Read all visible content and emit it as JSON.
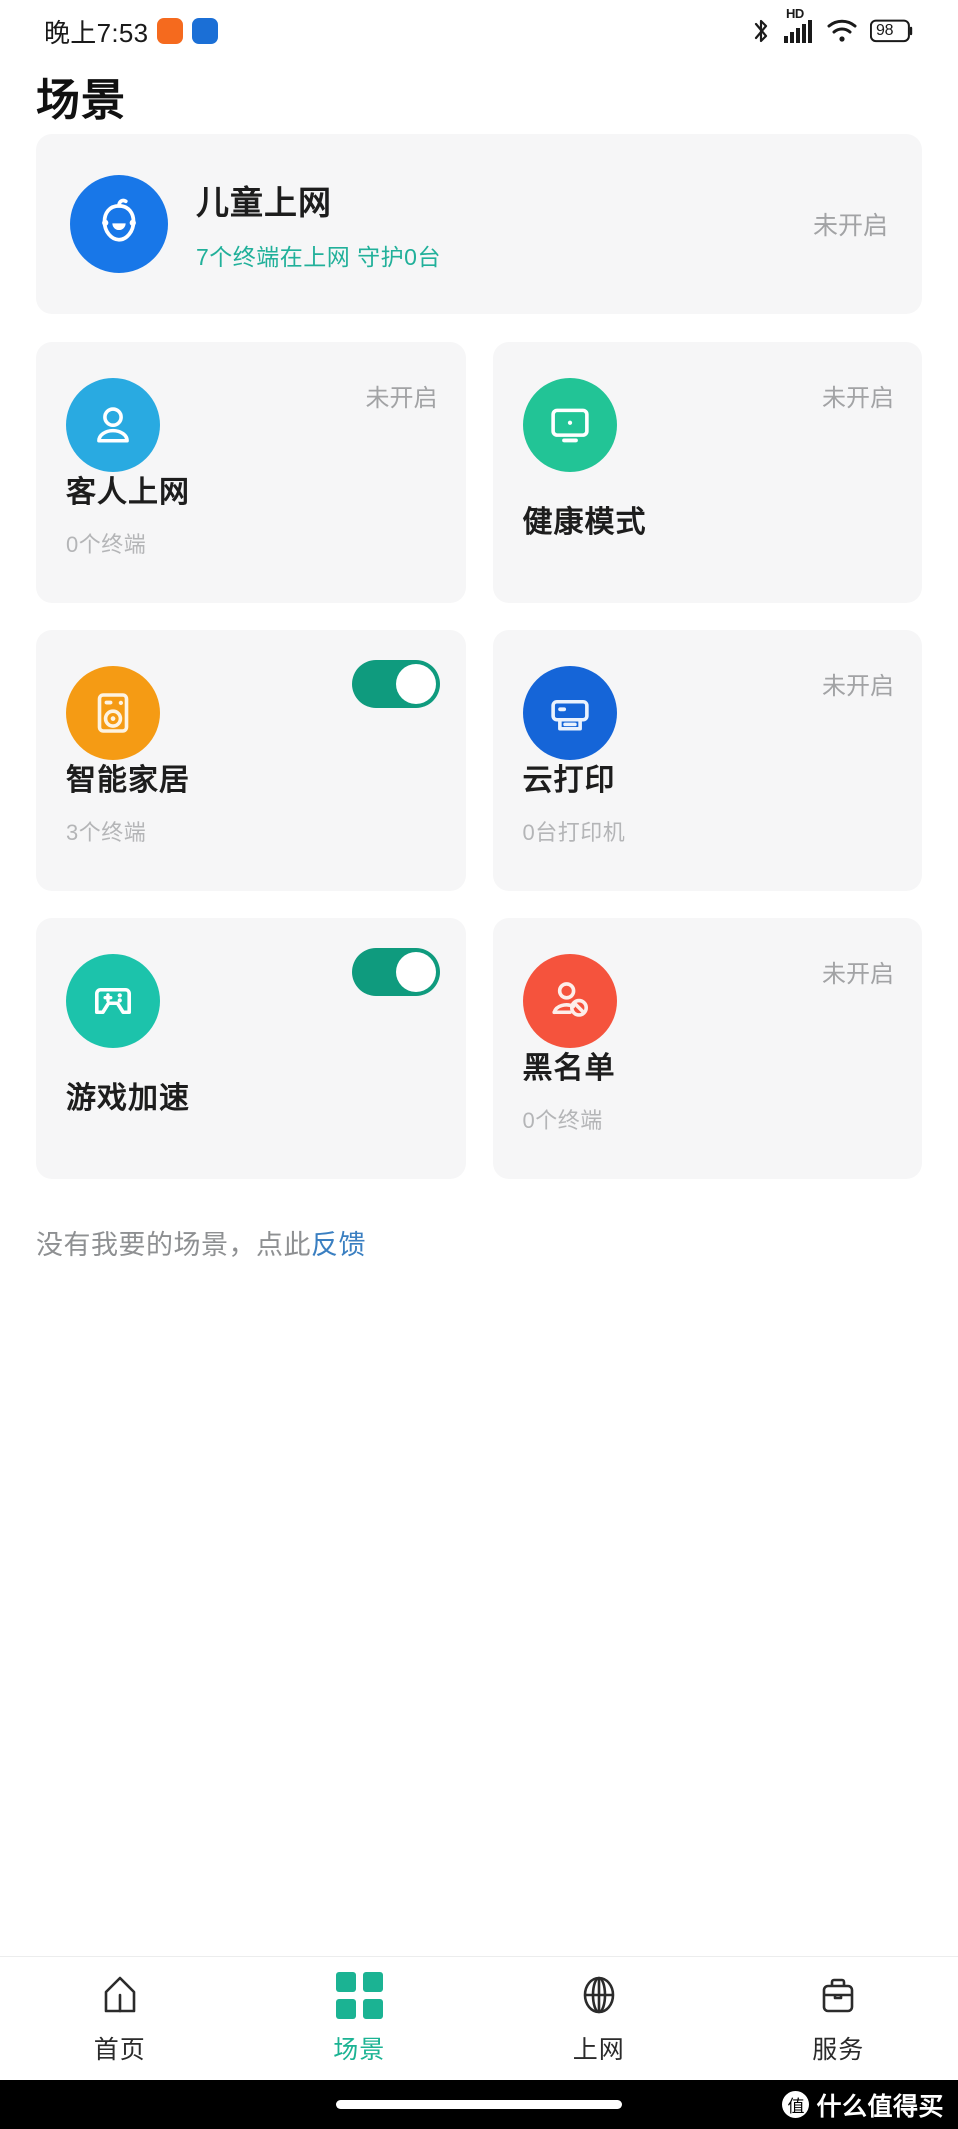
{
  "status_bar": {
    "time": "晚上7:53",
    "app_icons": [
      {
        "name": "mi-app-icon",
        "color": "#f56a1e"
      },
      {
        "name": "blue-app-icon",
        "color": "#1b6fd6"
      }
    ],
    "bluetooth_icon": "bluetooth-icon",
    "network_label": "HD",
    "signal_icon": "cellular-signal-icon",
    "wifi_icon": "wifi-icon",
    "battery_level": "98"
  },
  "header": {
    "title": "场景"
  },
  "hero_card": {
    "title": "儿童上网",
    "subtitle": "7个终端在上网  守护0台",
    "status": "未开启",
    "icon": "baby-face-icon",
    "icon_color": "#1877e8",
    "subtitle_color": "#21b09a"
  },
  "scene_cards": [
    {
      "title": "客人上网",
      "subtitle": "0个终端",
      "status": "未开启",
      "control": "status",
      "icon": "guest-person-icon",
      "icon_color": "#29aae1"
    },
    {
      "title": "健康模式",
      "subtitle": "",
      "status": "未开启",
      "control": "status",
      "icon": "monitor-icon",
      "icon_color": "#22c496"
    },
    {
      "title": "智能家居",
      "subtitle": "3个终端",
      "status": "",
      "control": "toggle",
      "toggle_on": true,
      "icon": "smart-appliance-icon",
      "icon_color": "#f59b14"
    },
    {
      "title": "云打印",
      "subtitle": "0台打印机",
      "status": "未开启",
      "control": "status",
      "icon": "printer-icon",
      "icon_color": "#1565d8"
    },
    {
      "title": "游戏加速",
      "subtitle": "",
      "status": "",
      "control": "toggle",
      "toggle_on": true,
      "icon": "gamepad-icon",
      "icon_color": "#1cc3ab"
    },
    {
      "title": "黑名单",
      "subtitle": "0个终端",
      "status": "未开启",
      "control": "status",
      "icon": "blocked-user-icon",
      "icon_color": "#f5533d"
    }
  ],
  "feedback": {
    "text": "没有我要的场景，点此",
    "link_text": "反馈"
  },
  "tabbar": {
    "items": [
      {
        "label": "首页",
        "icon": "home-icon",
        "active": false
      },
      {
        "label": "场景",
        "icon": "grid-icon",
        "active": true
      },
      {
        "label": "上网",
        "icon": "globe-icon",
        "active": false
      },
      {
        "label": "服务",
        "icon": "briefcase-icon",
        "active": false
      }
    ],
    "active_color": "#1bb393"
  },
  "watermark": {
    "badge": "值",
    "text": "什么值得买"
  }
}
